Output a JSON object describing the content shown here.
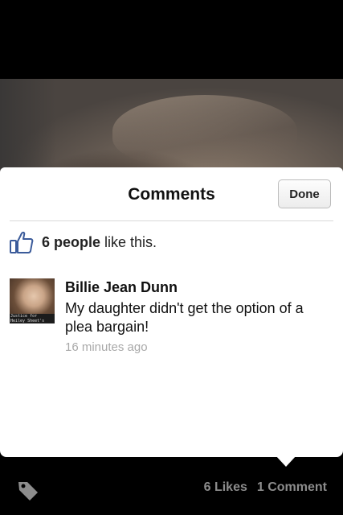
{
  "photo": {
    "alt": "photo"
  },
  "panel": {
    "title": "Comments",
    "done_label": "Done"
  },
  "likes": {
    "count_text": "6 people",
    "suffix_text": " like this."
  },
  "comments": [
    {
      "author": "Billie Jean Dunn",
      "text": "My daughter didn't get the option of a plea bargain!",
      "time": "16 minutes ago",
      "avatar_caption": "Justice for Heiley Sheet's"
    }
  ],
  "bottom_bar": {
    "likes_label": "6 Likes",
    "comments_label": "1 Comment",
    "tag_icon": "tag-icon"
  },
  "colors": {
    "thumb_blue": "#3b5b9a",
    "secondary_text": "#a9a9a9",
    "bar_text": "#8c8c8c"
  }
}
